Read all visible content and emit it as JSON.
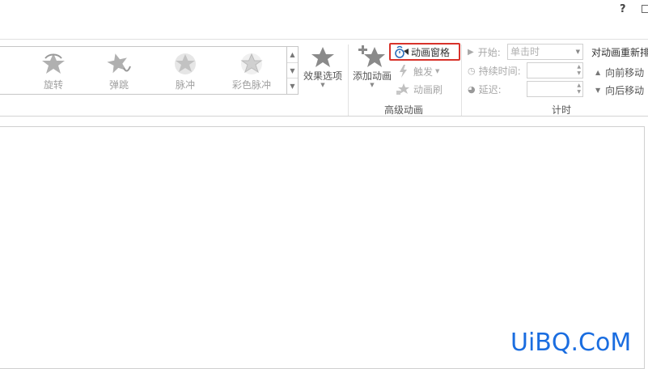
{
  "window": {
    "help_label": "?"
  },
  "gallery": {
    "items": [
      {
        "label": "旋转",
        "icon": "spin-star-icon"
      },
      {
        "label": "弹跳",
        "icon": "bounce-star-icon"
      },
      {
        "label": "脉冲",
        "icon": "pulse-star-icon"
      },
      {
        "label": "彩色脉冲",
        "icon": "color-pulse-star-icon"
      }
    ]
  },
  "effect_options": {
    "label": "效果选项"
  },
  "advanced_animation": {
    "group_label": "高级动画",
    "add_animation": "添加动画",
    "animation_pane": "动画窗格",
    "trigger": "触发",
    "animation_painter": "动画刷"
  },
  "timing": {
    "group_label": "计时",
    "start_label": "开始:",
    "start_value": "单击时",
    "duration_label": "持续时间:",
    "duration_value": "",
    "delay_label": "延迟:",
    "delay_value": ""
  },
  "reorder": {
    "title": "对动画重新排",
    "move_earlier": "向前移动",
    "move_later": "向后移动"
  },
  "watermark": {
    "text": "UiBQ.CoM"
  },
  "colors": {
    "accent_red": "#d8322b",
    "watermark_blue": "#1a6de0",
    "disabled_gray": "#a8a8a8"
  }
}
